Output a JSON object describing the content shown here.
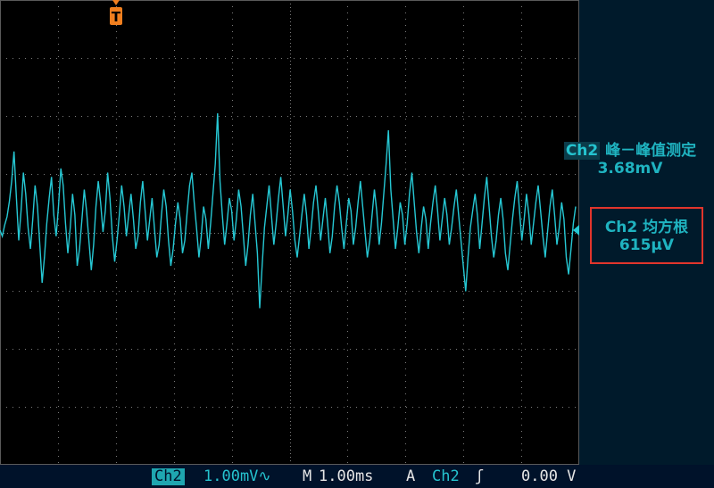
{
  "trigger_marker": {
    "label": "T",
    "color": "#f07f1f"
  },
  "trace": {
    "color": "#26c8d4",
    "samples": [
      2,
      -5,
      8,
      18,
      36,
      60,
      95,
      40,
      -10,
      25,
      70,
      45,
      5,
      -20,
      15,
      55,
      30,
      -15,
      -60,
      -30,
      10,
      40,
      65,
      20,
      -5,
      30,
      75,
      55,
      10,
      -25,
      5,
      45,
      20,
      -40,
      -20,
      15,
      50,
      25,
      -10,
      -45,
      -15,
      30,
      60,
      35,
      0,
      25,
      70,
      40,
      -5,
      -35,
      -10,
      20,
      55,
      30,
      -5,
      20,
      45,
      15,
      -20,
      -5,
      35,
      60,
      25,
      -10,
      15,
      40,
      5,
      -30,
      -15,
      20,
      50,
      30,
      -10,
      -40,
      -20,
      10,
      35,
      15,
      -25,
      -10,
      25,
      55,
      70,
      35,
      5,
      -30,
      -5,
      30,
      15,
      -20,
      10,
      45,
      80,
      140,
      60,
      20,
      -15,
      10,
      40,
      25,
      -10,
      15,
      50,
      30,
      -5,
      -40,
      -15,
      20,
      45,
      10,
      -25,
      -90,
      -40,
      5,
      30,
      55,
      20,
      -15,
      10,
      40,
      65,
      30,
      -5,
      20,
      50,
      25,
      -10,
      -30,
      -5,
      20,
      45,
      20,
      -20,
      5,
      35,
      55,
      25,
      -10,
      15,
      40,
      10,
      -25,
      -5,
      30,
      55,
      35,
      5,
      -20,
      10,
      40,
      25,
      -15,
      5,
      35,
      60,
      30,
      0,
      -30,
      -10,
      20,
      50,
      25,
      -15,
      10,
      45,
      80,
      120,
      50,
      15,
      -20,
      5,
      35,
      20,
      -15,
      10,
      45,
      70,
      35,
      0,
      -25,
      5,
      30,
      15,
      -20,
      10,
      35,
      55,
      25,
      -10,
      15,
      40,
      20,
      -15,
      5,
      30,
      50,
      20,
      -10,
      -40,
      -70,
      -30,
      5,
      25,
      45,
      20,
      -20,
      10,
      40,
      65,
      30,
      -5,
      -30,
      -10,
      20,
      40,
      15,
      -25,
      -45,
      -15,
      15,
      40,
      60,
      25,
      -10,
      15,
      45,
      20,
      -15,
      10,
      35,
      55,
      25,
      -5,
      -30,
      0,
      30,
      50,
      20,
      -15,
      5,
      35,
      15,
      -30,
      -50,
      -20,
      10,
      30
    ]
  },
  "measurements": [
    {
      "channel": "Ch2",
      "name": "峰－峰值测定",
      "value": "3.68mV"
    },
    {
      "channel": "Ch2",
      "name": "均方根",
      "value": "615µV"
    }
  ],
  "status_bar": {
    "channel": "Ch2",
    "volts_div": "1.00mV∿",
    "horiz_mark": "M",
    "time_div": "1.00ms",
    "acq_mode": "A",
    "trigger_channel": "Ch2",
    "trigger_edge": "ʃ",
    "trigger_level": "0.00 V"
  }
}
